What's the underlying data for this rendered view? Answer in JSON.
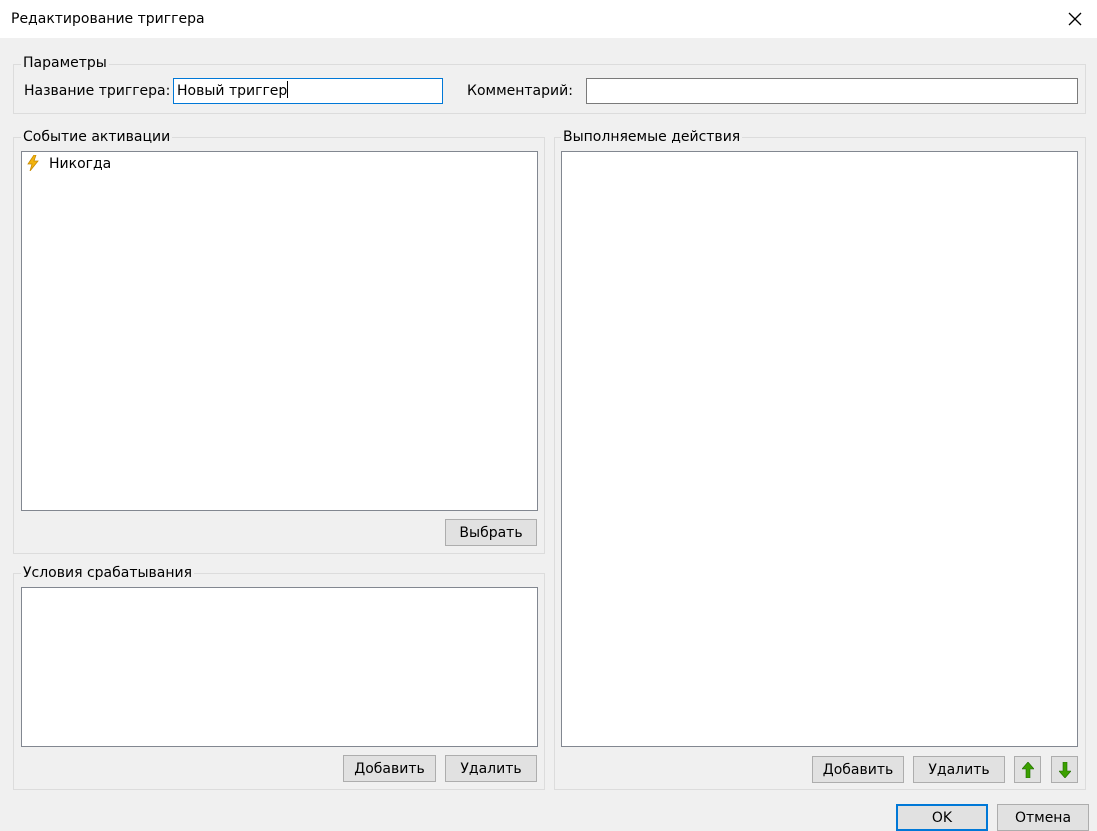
{
  "window": {
    "title": "Редактирование триггера"
  },
  "params": {
    "legend": "Параметры",
    "name_label": "Название триггера:",
    "name_value": "Новый триггер",
    "comment_label": "Комментарий:",
    "comment_value": ""
  },
  "activation": {
    "legend": "Событие активации",
    "items": [
      {
        "icon": "lightning-icon",
        "label": "Никогда"
      }
    ],
    "select_label": "Выбрать"
  },
  "conditions": {
    "legend": "Условия срабатывания",
    "items": [],
    "add_label": "Добавить",
    "remove_label": "Удалить"
  },
  "actions": {
    "legend": "Выполняемые действия",
    "items": [],
    "add_label": "Добавить",
    "remove_label": "Удалить",
    "move_up_icon": "arrow-up-icon",
    "move_down_icon": "arrow-down-icon"
  },
  "footer": {
    "ok_label": "OK",
    "cancel_label": "Отмена"
  },
  "colors": {
    "accent": "#0078d7",
    "arrow_green": "#3ca000",
    "lightning": "#f2b40e"
  }
}
